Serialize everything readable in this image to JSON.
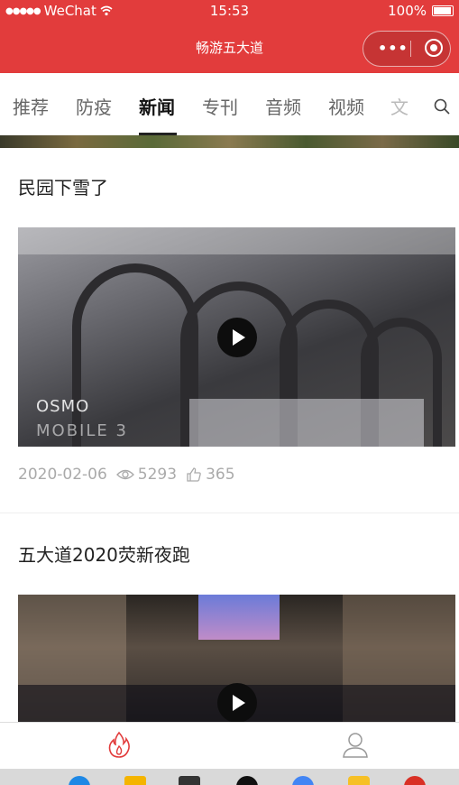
{
  "status_bar": {
    "carrier": "WeChat",
    "time": "15:53",
    "battery": "100%"
  },
  "title_bar": {
    "title": "畅游五大道"
  },
  "tabs": [
    {
      "label": "推荐",
      "active": false
    },
    {
      "label": "防疫",
      "active": false
    },
    {
      "label": "新闻",
      "active": true
    },
    {
      "label": "专刊",
      "active": false
    },
    {
      "label": "音频",
      "active": false
    },
    {
      "label": "视频",
      "active": false
    },
    {
      "label": "文",
      "active": false
    }
  ],
  "feed": [
    {
      "title": "民园下雪了",
      "video_watermark_1": "OSMO",
      "video_watermark_2": "MOBILE 3",
      "date": "2020-02-06",
      "views": "5293",
      "likes": "365"
    },
    {
      "title": "五大道2020荧新夜跑"
    }
  ],
  "colors": {
    "brand_red": "#e23c3c",
    "meta_gray": "#aaaaaa"
  },
  "bottom_nav": [
    {
      "icon": "flame-icon",
      "active": true
    },
    {
      "icon": "user-icon",
      "active": false
    }
  ]
}
